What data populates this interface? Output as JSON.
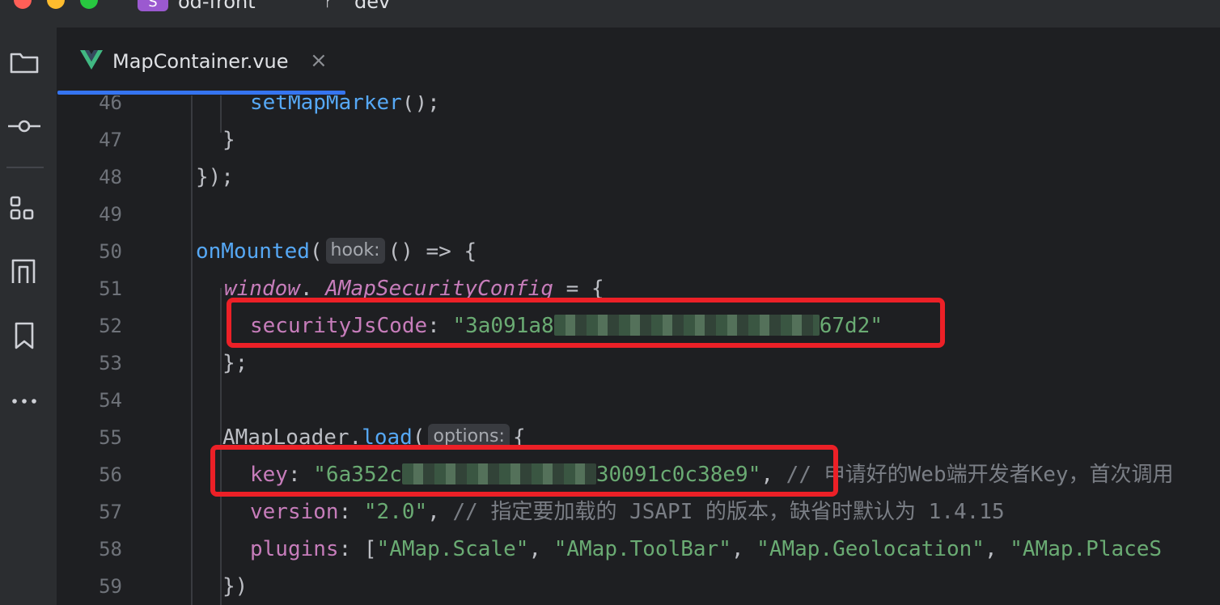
{
  "titlebar": {
    "project_badge": "S",
    "project_name": "od-front",
    "branch_name": "dev"
  },
  "tab": {
    "label": "MapContainer.vue",
    "close": "×"
  },
  "colors": {
    "accent": "#3574f0",
    "highlight_box": "#ec2027",
    "vue_green": "#41b883",
    "string": "#6aab73",
    "function": "#56a8f5",
    "property": "#c77dbb"
  },
  "icons": [
    "folder-icon",
    "commit-icon",
    "structure-icon",
    "pull-request-icon",
    "bookmark-icon",
    "more-icon",
    "vue-file-icon",
    "close-icon",
    "branch-icon"
  ],
  "code": {
    "line_numbers": [
      "46",
      "47",
      "48",
      "49",
      "50",
      "51",
      "52",
      "53",
      "54",
      "55",
      "56",
      "57",
      "58",
      "59"
    ],
    "l46": {
      "fn": "setMapMarker",
      "rest": "();"
    },
    "l47": {
      "text": "}"
    },
    "l48": {
      "text": "});"
    },
    "l50": {
      "fn": "onMounted",
      "open": "(",
      "hint": "hook:",
      "rest": "() => {"
    },
    "l51": {
      "obj": "window",
      "dot": ".",
      "prop": "_AMapSecurityConfig",
      "rest": " = {"
    },
    "l52": {
      "prop": "securityJsCode",
      "colon": ": ",
      "str_start": "\"3a091a8",
      "str_end": "67d2\""
    },
    "l53": {
      "text": "};"
    },
    "l55": {
      "obj": "AMapLoader",
      "dot": ".",
      "fn": "load",
      "open": "(",
      "hint": "options:",
      "rest": "{"
    },
    "l56": {
      "prop": "key",
      "colon": ": ",
      "str_start": "\"6a352c",
      "str_end": "30091c0c38e9\"",
      "comma": ", ",
      "comment": "// 申请好的Web端开发者Key，首次调用"
    },
    "l57": {
      "prop": "version",
      "colon": ": ",
      "str": "\"2.0\"",
      "comma": ", ",
      "comment": "// 指定要加载的 JSAPI 的版本，缺省时默认为 1.4.15"
    },
    "l58": {
      "prop": "plugins",
      "colon": ": ",
      "open": "[",
      "s1": "\"AMap.Scale\"",
      "s2": "\"AMap.ToolBar\"",
      "s3": "\"AMap.Geolocation\"",
      "s4": "\"AMap.PlaceS",
      "sep": ", "
    },
    "l59": {
      "text": "})"
    }
  }
}
